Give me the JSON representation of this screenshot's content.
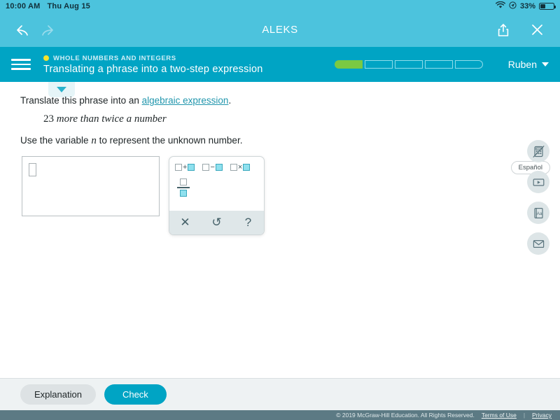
{
  "status_bar": {
    "time": "10:00 AM",
    "date": "Thu Aug 15",
    "battery_percent": "33%",
    "wifi_icon": "wifi-icon",
    "location_icon": "location-icon",
    "battery_icon": "battery-icon"
  },
  "browser_nav": {
    "back_icon": "back-arrow-icon",
    "forward_icon": "forward-arrow-icon",
    "title": "ALEKS",
    "share_icon": "share-icon",
    "close_icon": "close-icon"
  },
  "app_header": {
    "menu_icon": "hamburger-menu-icon",
    "topic": "WHOLE NUMBERS AND INTEGERS",
    "topic_dot_color": "#f5e32a",
    "title": "Translating a phrase into a two-step expression",
    "progress": {
      "total_segments": 5,
      "filled_segments": 1,
      "fill_color": "#7ac943"
    },
    "user_name": "Ruben",
    "user_caret_icon": "chevron-down-icon",
    "background_color": "#00a4c4"
  },
  "content": {
    "pull_tab_icon": "triangle-down-icon",
    "espanol_label": "Español",
    "instruction_prefix": "Translate this phrase into an ",
    "instruction_link": "algebraic expression",
    "instruction_suffix": ".",
    "phrase_number": "23",
    "phrase_text": " more than twice a number",
    "variable_prefix": "Use the variable ",
    "variable_name": "n",
    "variable_suffix": " to represent the unknown number.",
    "answer_value": ""
  },
  "keypad": {
    "keys": [
      {
        "name": "plus-key",
        "symbol": "+"
      },
      {
        "name": "minus-key",
        "symbol": "−"
      },
      {
        "name": "times-key",
        "symbol": "×"
      }
    ],
    "fraction_key": "fraction-key",
    "footer": {
      "clear_label": "✕",
      "undo_label": "↺",
      "help_label": "?"
    }
  },
  "tool_rail": {
    "calculator_icon": "calculator-disabled-icon",
    "video_icon": "video-play-icon",
    "dictionary_icon": "dictionary-icon",
    "mail_icon": "mail-envelope-icon"
  },
  "action_bar": {
    "explanation_label": "Explanation",
    "check_label": "Check",
    "check_color": "#00a4c4"
  },
  "footer": {
    "copyright": "© 2019 McGraw-Hill Education. All Rights Reserved.",
    "terms_label": "Terms of Use",
    "separator": "|",
    "privacy_label": "Privacy"
  }
}
